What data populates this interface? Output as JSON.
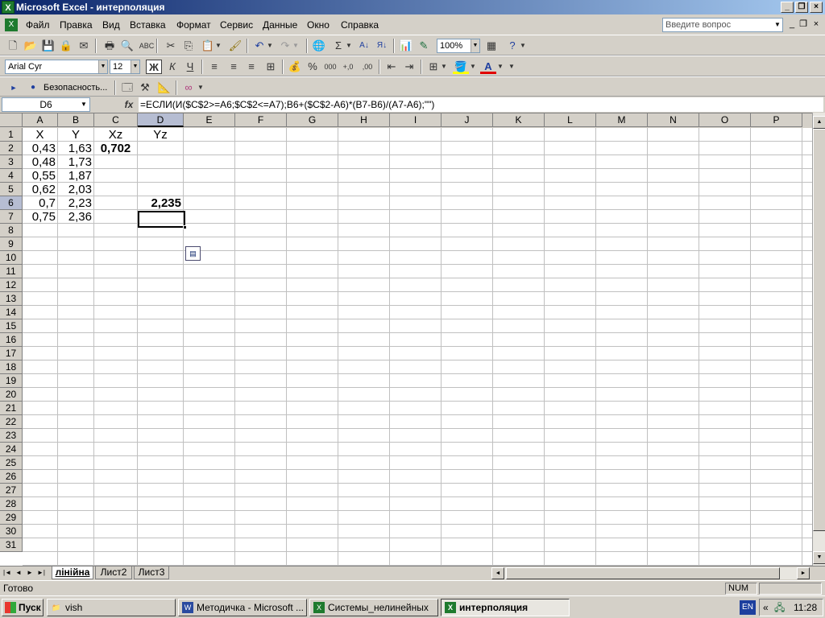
{
  "window": {
    "title": "Microsoft Excel - интерполяция"
  },
  "menu": {
    "items": [
      "Файл",
      "Правка",
      "Вид",
      "Вставка",
      "Формат",
      "Сервис",
      "Данные",
      "Окно",
      "Справка"
    ],
    "ask_placeholder": "Введите вопрос"
  },
  "toolbar": {
    "zoom": "100%",
    "font_name": "Arial Cyr",
    "font_size": "12",
    "bold_label": "Ж",
    "italic_label": "К",
    "underline_label": "Ч",
    "percent_label": "%",
    "thousands_label": "000",
    "security_label": "Безопасность..."
  },
  "formula_bar": {
    "cell_ref": "D6",
    "fx_label": "fx",
    "formula": "=ЕСЛИ(И($C$2>=A6;$C$2<=A7);B6+($C$2-A6)*(B7-B6)/(A7-A6);\"\")"
  },
  "grid": {
    "columns": [
      "A",
      "B",
      "C",
      "D",
      "E",
      "F",
      "G",
      "H",
      "I",
      "J",
      "K",
      "L",
      "M",
      "N",
      "O",
      "P"
    ],
    "rows": [
      "1",
      "2",
      "3",
      "4",
      "5",
      "6",
      "7",
      "8",
      "9",
      "10",
      "11",
      "12",
      "13",
      "14",
      "15",
      "16",
      "17",
      "18",
      "19",
      "20",
      "21",
      "22",
      "23",
      "24",
      "25",
      "26",
      "27",
      "28",
      "29",
      "30",
      "31"
    ],
    "selected_column": "D",
    "selected_row": "6",
    "cells": {
      "A1": "X",
      "B1": "Y",
      "C1": "Xz",
      "D1": "Yz",
      "A2": "0,43",
      "B2": "1,63",
      "C2": "0,702",
      "A3": "0,48",
      "B3": "1,73",
      "A4": "0,55",
      "B4": "1,87",
      "A5": "0,62",
      "B5": "2,03",
      "A6": "0,7",
      "B6": "2,23",
      "D6": "2,235",
      "A7": "0,75",
      "B7": "2,36"
    }
  },
  "sheets": {
    "tabs": [
      "лінійна",
      "Лист2",
      "Лист3"
    ],
    "active": "лінійна"
  },
  "status": {
    "text": "Готово",
    "num": "NUM"
  },
  "taskbar": {
    "start_label": "Пуск",
    "tasks": [
      "vish",
      "Методичка - Microsoft ...",
      "Системы_нелинейных",
      "интерполяция"
    ],
    "language": "EN",
    "clock": "11:28"
  }
}
